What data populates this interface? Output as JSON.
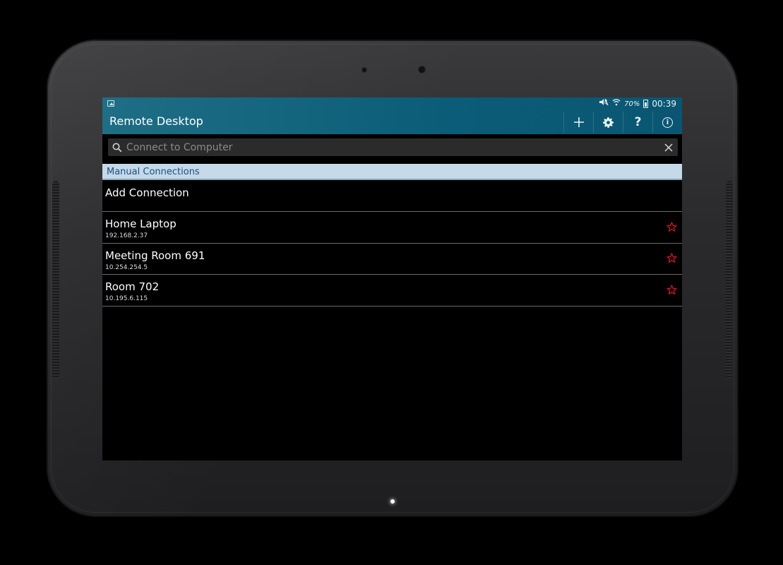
{
  "status": {
    "battery_percent": "70%",
    "time": "00:39"
  },
  "appbar": {
    "title": "Remote Desktop",
    "actions": {
      "add_icon": "plus-icon",
      "settings_icon": "gear-icon",
      "help_label": "?",
      "info_label": "i"
    }
  },
  "search": {
    "placeholder": "Connect to Computer",
    "value": ""
  },
  "section": {
    "title": "Manual Connections"
  },
  "list": {
    "add_label": "Add Connection",
    "connections": [
      {
        "name": "Home Laptop",
        "address": "192.168.2.37"
      },
      {
        "name": "Meeting Room 691",
        "address": "10.254.254.5"
      },
      {
        "name": "Room 702",
        "address": "10.195.6.115"
      }
    ]
  },
  "colors": {
    "appbar": "#0b5c78",
    "section_bg": "#c6d9e8",
    "section_text": "#1a4f86",
    "star": "#e0141e"
  }
}
